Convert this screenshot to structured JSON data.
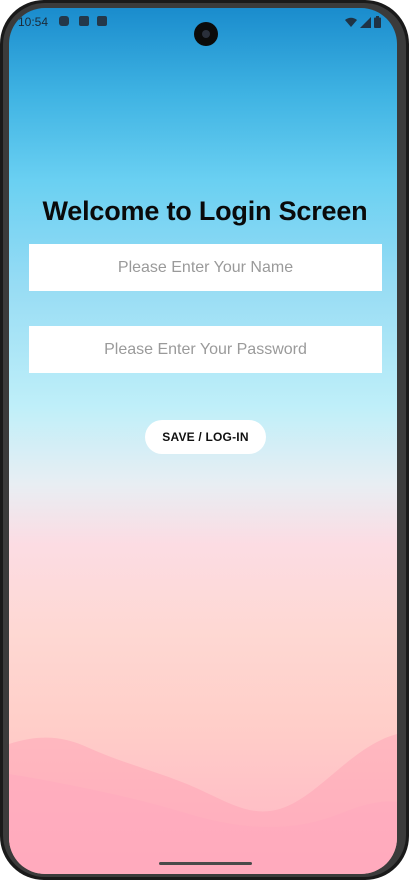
{
  "status_bar": {
    "time": "10:54",
    "left_icons": [
      "shield-icon",
      "sd-card-icon",
      "text-a-icon"
    ],
    "right_icons": [
      "wifi-icon",
      "cell-signal-icon",
      "battery-icon"
    ]
  },
  "login": {
    "title": "Welcome to Login Screen",
    "name_placeholder": "Please Enter Your Name",
    "name_value": "",
    "password_placeholder": "Please Enter Your Password",
    "password_value": "",
    "button_label": "SAVE / LOG-IN"
  },
  "colors": {
    "sky_top": "#1a8ccd",
    "sky_mid": "#97dcf4",
    "horizon": "#fcdce3",
    "ground_bottom": "#ffb4c4",
    "input_bg": "#ffffff",
    "button_bg": "#ffffff",
    "title_text": "#0a0a0a"
  }
}
